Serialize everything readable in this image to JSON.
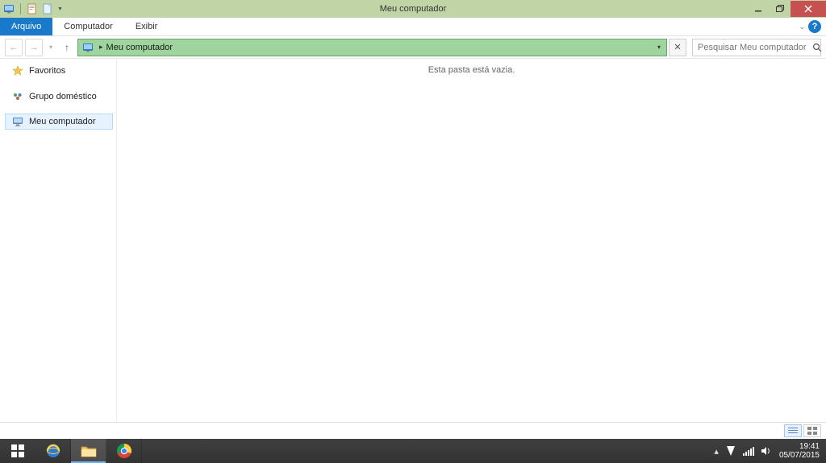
{
  "window": {
    "title": "Meu computador"
  },
  "ribbon": {
    "file": "Arquivo",
    "tabs": [
      "Computador",
      "Exibir"
    ]
  },
  "nav": {
    "location": "Meu computador",
    "search_placeholder": "Pesquisar Meu computador"
  },
  "sidebar": {
    "items": [
      {
        "label": "Favoritos",
        "icon": "star"
      },
      {
        "label": "Grupo doméstico",
        "icon": "homegroup"
      },
      {
        "label": "Meu computador",
        "icon": "computer",
        "selected": true
      }
    ]
  },
  "content": {
    "empty_message": "Esta pasta está vazia."
  },
  "system": {
    "time": "19:41",
    "date": "05/07/2015"
  }
}
